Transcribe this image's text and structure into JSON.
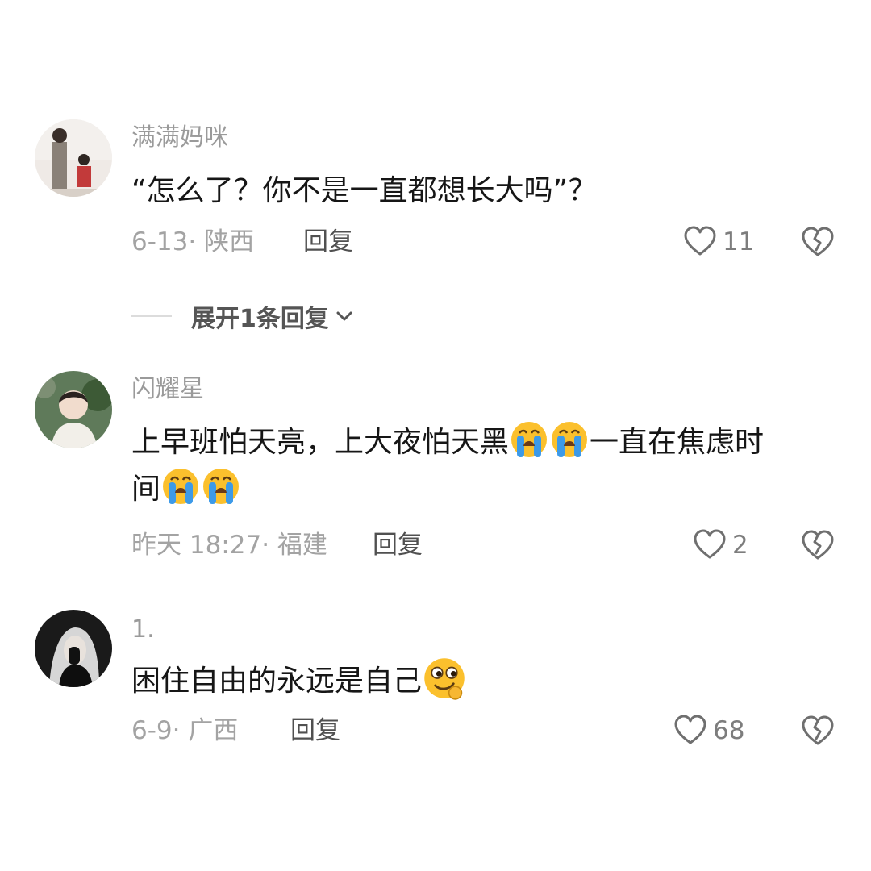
{
  "comments": [
    {
      "username": "满满妈咪",
      "text": "“怎么了？你不是一直都想长大吗”？",
      "meta": "6-13· 陕西",
      "reply_label": "回复",
      "likes": "11",
      "avatar_icon": "avatar-photo"
    },
    {
      "username": "闪耀星",
      "text_parts": [
        "上早班怕天亮，上大夜怕天黑",
        "一直在焦虑时",
        "间"
      ],
      "emoji": "loudly-crying-face",
      "meta": "昨天 18:27· 福建",
      "reply_label": "回复",
      "likes": "2",
      "avatar_icon": "avatar-photo"
    },
    {
      "username": "1.",
      "text": "困住自由的永远是自己",
      "emoji": "drooling-face",
      "meta": "6-9· 广西",
      "reply_label": "回复",
      "likes": "68",
      "avatar_icon": "avatar-photo"
    }
  ],
  "expand_replies": {
    "label": "展开1条回复",
    "icon": "chevron-down-icon"
  },
  "icons": {
    "like": "heart-icon",
    "dislike": "broken-heart-icon"
  },
  "colors": {
    "username": "#9a9a9a",
    "text": "#161616",
    "meta": "#a3a3a3",
    "emoji_face": "#fbc02d",
    "tears": "#3d9ae8"
  }
}
